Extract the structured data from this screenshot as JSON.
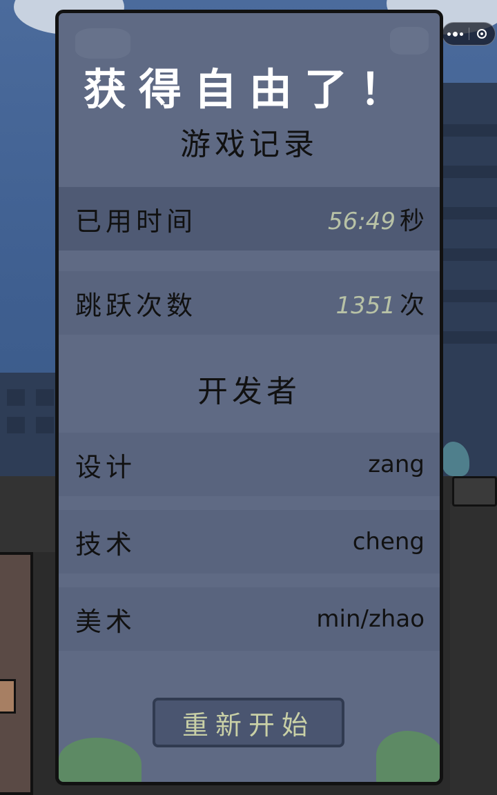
{
  "dialog": {
    "title": "获得自由了！",
    "record_heading": "游戏记录",
    "stats": [
      {
        "label": "已用时间",
        "value": "56:49",
        "unit": "秒"
      },
      {
        "label": "跳跃次数",
        "value": "1351",
        "unit": "次"
      }
    ],
    "developer_heading": "开发者",
    "credits": [
      {
        "role": "设计",
        "name": "zang"
      },
      {
        "role": "技术",
        "name": "cheng"
      },
      {
        "role": "美术",
        "name": "min/zhao"
      }
    ],
    "restart_label": "重新开始"
  },
  "capsule": {
    "more_icon": "more-dots-icon",
    "close_icon": "target-close-icon"
  },
  "colors": {
    "panel": "#5f6a84",
    "row": "#59647e",
    "row_highlight": "#4f5a74",
    "number_accent": "#b8c2a6",
    "button_text": "#c9d0a6"
  }
}
